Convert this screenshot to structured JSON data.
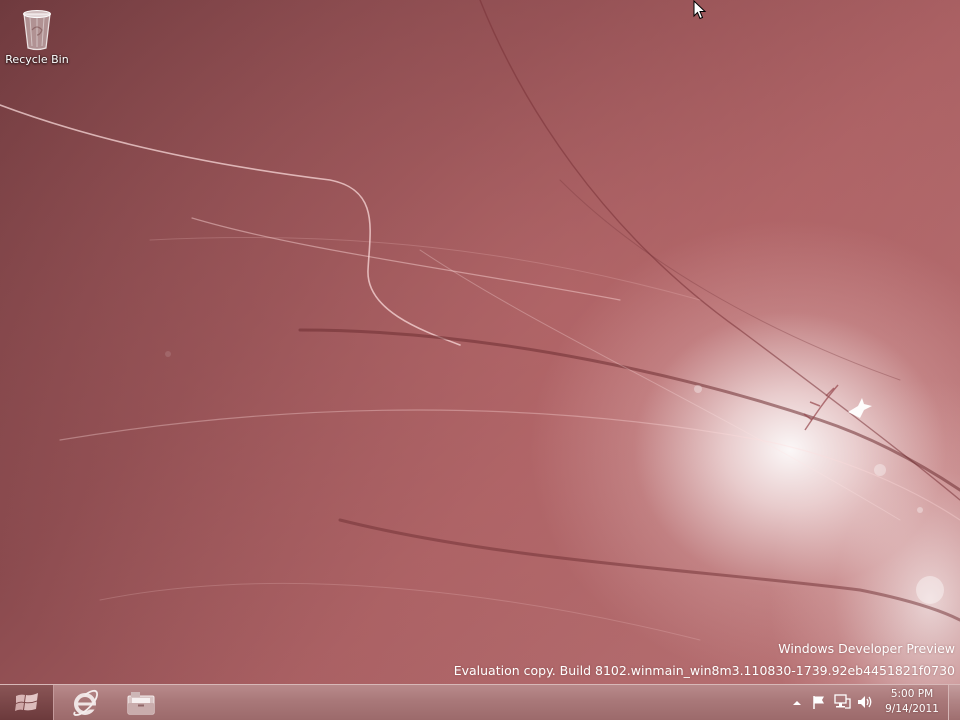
{
  "desktop": {
    "icons": [
      {
        "label": "Recycle Bin",
        "icon": "recycle-bin-icon"
      }
    ],
    "watermark": {
      "line1": "Windows Developer Preview",
      "line2": "Evaluation copy. Build 8102.winmain_win8m3.110830-1739.92eb4451821f0730"
    }
  },
  "taskbar": {
    "start_icon": "windows-logo-icon",
    "pinned": [
      {
        "app": "internet-explorer",
        "icon": "internet-explorer-icon"
      },
      {
        "app": "file-explorer",
        "icon": "folder-icon"
      }
    ],
    "tray": {
      "icons": [
        "show-hidden-icons-chevron",
        "action-center-flag-icon",
        "network-icon",
        "volume-icon"
      ],
      "clock": {
        "time": "5:00 PM",
        "date": "9/14/2011"
      }
    }
  },
  "colors": {
    "desktop_base": "#8a4a4e",
    "taskbar": "#a97879",
    "text": "#ffffff"
  }
}
